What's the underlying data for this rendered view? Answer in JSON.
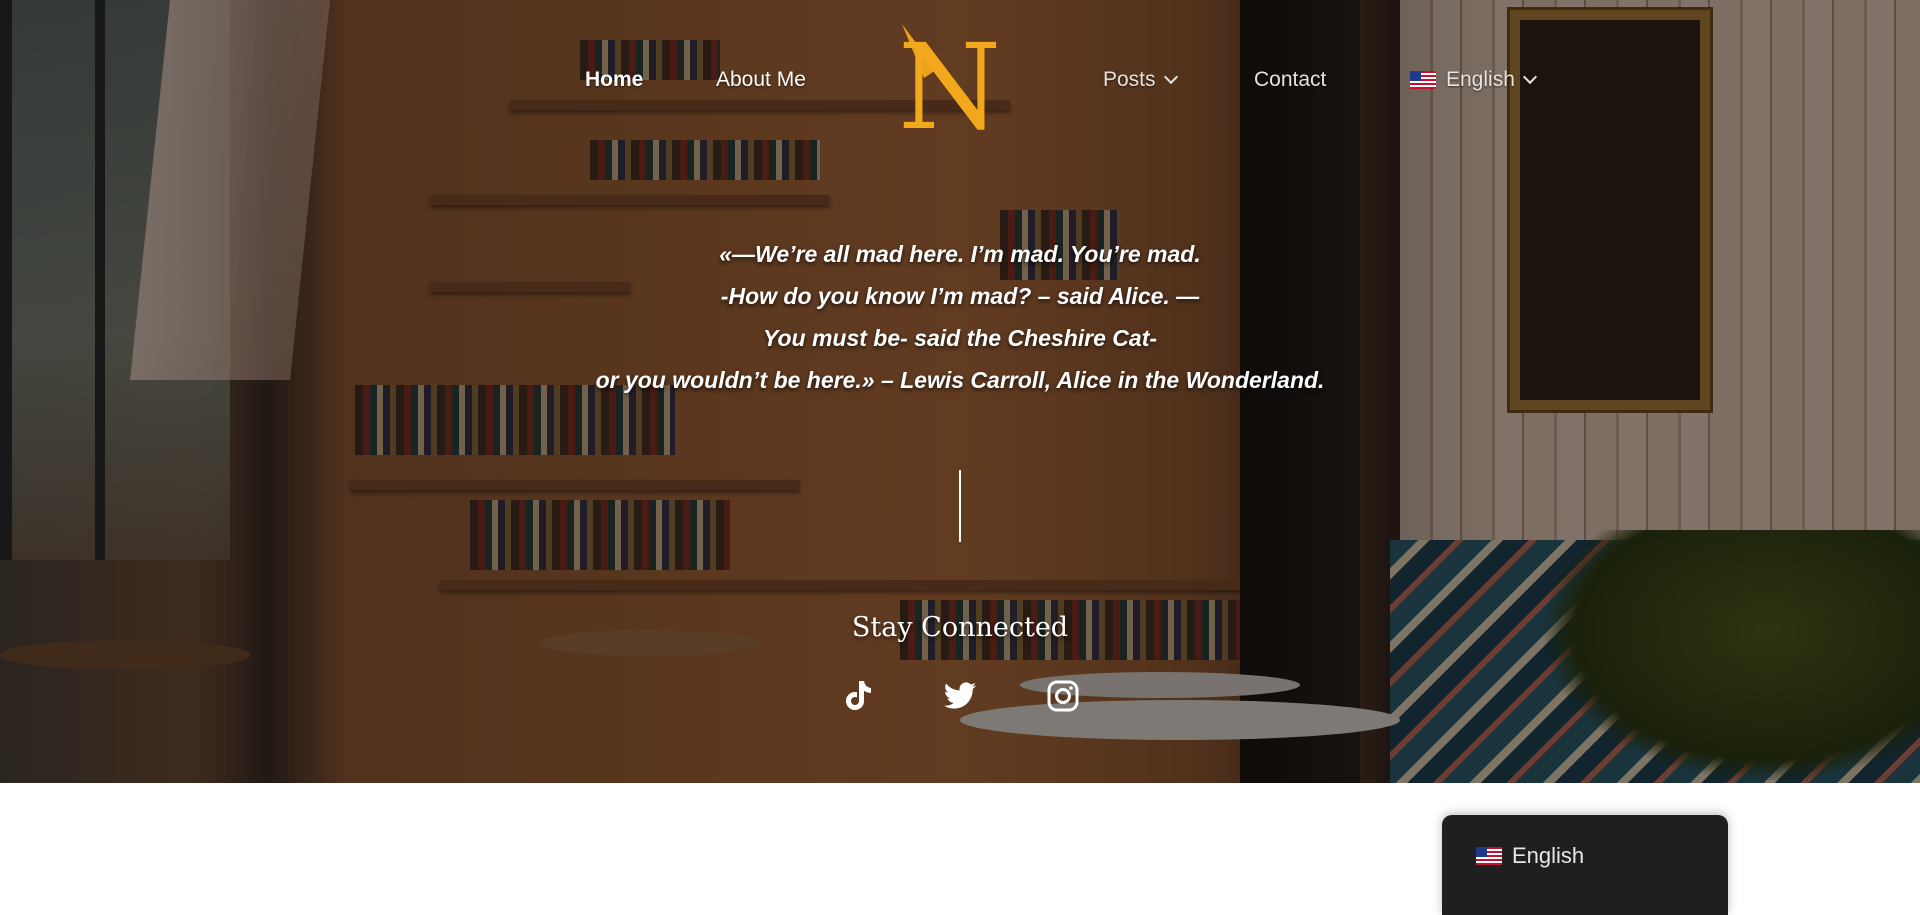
{
  "nav": {
    "home_label": "Home",
    "about_label": "About Me",
    "posts_label": "Posts",
    "contact_label": "Contact",
    "language_label": "English"
  },
  "logo": {
    "letter": "N",
    "color": "#f2a81d"
  },
  "quote": {
    "line1": "«—We’re all mad here. I’m mad. You’re mad.",
    "line2": "-How do you know I’m mad? – said Alice. —",
    "line3": "You must be- said the Cheshire Cat-",
    "line4": "or you wouldn’t be here.» – Lewis Carroll, Alice in the Wonderland."
  },
  "social": {
    "heading": "Stay Connected",
    "icons": [
      "tiktok-icon",
      "twitter-icon",
      "instagram-icon"
    ]
  },
  "language_switcher": {
    "current": "English"
  },
  "colors": {
    "accent": "#f2a81d",
    "popup_bg": "#1f1f1f"
  }
}
